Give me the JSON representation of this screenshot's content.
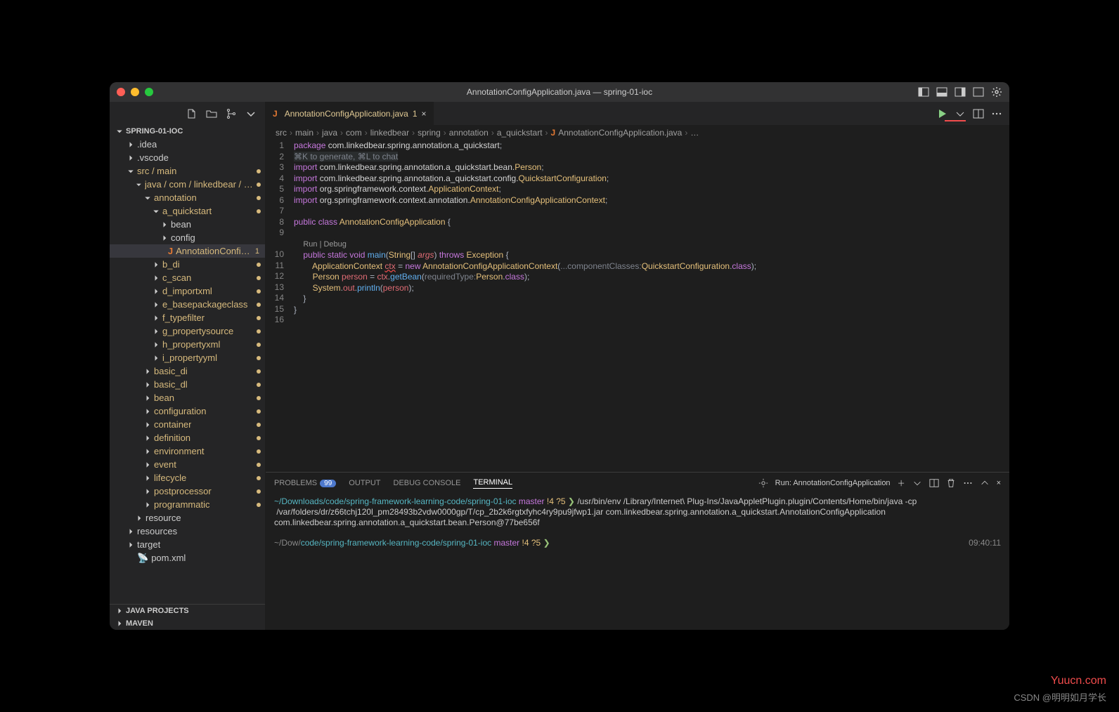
{
  "title": "AnnotationConfigApplication.java — spring-01-ioc",
  "sidebar": {
    "project": "SPRING-01-IOC",
    "items": [
      {
        "lvl": 1,
        "kind": "fold",
        "open": false,
        "mod": 0,
        "label": ".idea"
      },
      {
        "lvl": 1,
        "kind": "fold",
        "open": false,
        "mod": 0,
        "label": ".vscode"
      },
      {
        "lvl": 1,
        "kind": "fold",
        "open": true,
        "mod": 1,
        "label": "src / main",
        "cls": "yell"
      },
      {
        "lvl": 2,
        "kind": "fold",
        "open": true,
        "mod": 1,
        "label": "java / com / linkedbear / spring",
        "cls": "yell"
      },
      {
        "lvl": 3,
        "kind": "fold",
        "open": true,
        "mod": 1,
        "label": "annotation",
        "cls": "yell"
      },
      {
        "lvl": 4,
        "kind": "fold",
        "open": true,
        "mod": 1,
        "label": "a_quickstart",
        "cls": "yell"
      },
      {
        "lvl": 5,
        "kind": "fold",
        "open": false,
        "mod": 0,
        "label": "bean"
      },
      {
        "lvl": 5,
        "kind": "fold",
        "open": false,
        "mod": 0,
        "label": "config"
      },
      {
        "lvl": 5,
        "kind": "file",
        "mod": 0,
        "num": "1",
        "label": "AnnotationConfigApplica...",
        "sel": true,
        "java": true,
        "cls": "yell"
      },
      {
        "lvl": 4,
        "kind": "fold",
        "open": false,
        "mod": 1,
        "label": "b_di",
        "cls": "yell"
      },
      {
        "lvl": 4,
        "kind": "fold",
        "open": false,
        "mod": 1,
        "label": "c_scan",
        "cls": "yell"
      },
      {
        "lvl": 4,
        "kind": "fold",
        "open": false,
        "mod": 1,
        "label": "d_importxml",
        "cls": "yell"
      },
      {
        "lvl": 4,
        "kind": "fold",
        "open": false,
        "mod": 1,
        "label": "e_basepackageclass",
        "cls": "yell"
      },
      {
        "lvl": 4,
        "kind": "fold",
        "open": false,
        "mod": 1,
        "label": "f_typefilter",
        "cls": "yell"
      },
      {
        "lvl": 4,
        "kind": "fold",
        "open": false,
        "mod": 1,
        "label": "g_propertysource",
        "cls": "yell"
      },
      {
        "lvl": 4,
        "kind": "fold",
        "open": false,
        "mod": 1,
        "label": "h_propertyxml",
        "cls": "yell"
      },
      {
        "lvl": 4,
        "kind": "fold",
        "open": false,
        "mod": 1,
        "label": "i_propertyyml",
        "cls": "yell"
      },
      {
        "lvl": 3,
        "kind": "fold",
        "open": false,
        "mod": 1,
        "label": "basic_di",
        "cls": "yell"
      },
      {
        "lvl": 3,
        "kind": "fold",
        "open": false,
        "mod": 1,
        "label": "basic_dl",
        "cls": "yell"
      },
      {
        "lvl": 3,
        "kind": "fold",
        "open": false,
        "mod": 1,
        "label": "bean",
        "cls": "yell"
      },
      {
        "lvl": 3,
        "kind": "fold",
        "open": false,
        "mod": 1,
        "label": "configuration",
        "cls": "yell"
      },
      {
        "lvl": 3,
        "kind": "fold",
        "open": false,
        "mod": 1,
        "label": "container",
        "cls": "yell"
      },
      {
        "lvl": 3,
        "kind": "fold",
        "open": false,
        "mod": 1,
        "label": "definition",
        "cls": "yell"
      },
      {
        "lvl": 3,
        "kind": "fold",
        "open": false,
        "mod": 1,
        "label": "environment",
        "cls": "yell"
      },
      {
        "lvl": 3,
        "kind": "fold",
        "open": false,
        "mod": 1,
        "label": "event",
        "cls": "yell"
      },
      {
        "lvl": 3,
        "kind": "fold",
        "open": false,
        "mod": 1,
        "label": "lifecycle",
        "cls": "yell"
      },
      {
        "lvl": 3,
        "kind": "fold",
        "open": false,
        "mod": 1,
        "label": "postprocessor",
        "cls": "yell"
      },
      {
        "lvl": 3,
        "kind": "fold",
        "open": false,
        "mod": 1,
        "label": "programmatic",
        "cls": "yell"
      },
      {
        "lvl": 2,
        "kind": "fold",
        "open": false,
        "mod": 0,
        "label": "resource"
      },
      {
        "lvl": 1,
        "kind": "fold",
        "open": false,
        "mod": 0,
        "label": "resources"
      },
      {
        "lvl": 1,
        "kind": "fold",
        "open": false,
        "mod": 0,
        "label": "target"
      },
      {
        "lvl": 1,
        "kind": "file",
        "mod": 0,
        "label": "pom.xml",
        "xml": true
      }
    ],
    "bottom": [
      "JAVA PROJECTS",
      "MAVEN"
    ]
  },
  "tab": {
    "name": "AnnotationConfigApplication.java",
    "badge": "1"
  },
  "crumbs": [
    "src",
    "main",
    "java",
    "com",
    "linkedbear",
    "spring",
    "annotation",
    "a_quickstart",
    "AnnotationConfigApplication.java",
    "…"
  ],
  "code": {
    "lines": [
      1,
      2,
      3,
      4,
      5,
      6,
      7,
      8,
      9,
      10,
      11,
      12,
      13,
      14,
      15,
      16
    ],
    "hint": "⌘K to generate, ⌘L to chat",
    "codelens": "Run | Debug"
  },
  "panel": {
    "tabs": {
      "problems": "PROBLEMS",
      "problems_count": "99",
      "output": "OUTPUT",
      "debug": "DEBUG CONSOLE",
      "terminal": "TERMINAL"
    },
    "run_label": "Run: AnnotationConfigApplication",
    "time": "09:40:11",
    "term": {
      "l1_path": "~/Downloads/code/spring-framework-learning-code/spring-01-ioc",
      "branch": "master",
      "flags": "!4 ?5",
      "cmd": "/usr/bin/env /Library/Internet\\ Plug-Ins/JavaAppletPlugin.plugin/Contents/Home/bin/java -cp",
      "l2": "/var/folders/dr/z66tchj120l_pm28493b2vdw0000gp/T/cp_2b2k6rgtxfyhc4ry9pu9jfwp1.jar com.linkedbear.spring.annotation.a_quickstart.AnnotationConfigApplication",
      "l3": "com.linkedbear.spring.annotation.a_quickstart.bean.Person@77be656f",
      "l4_path_a": "~/Dow/",
      "l4_path_b": "code/spring-framework-learning-code/spring-01-ioc"
    }
  },
  "watermark": "Yuucn.com",
  "csdn": "CSDN @明明如月学长"
}
